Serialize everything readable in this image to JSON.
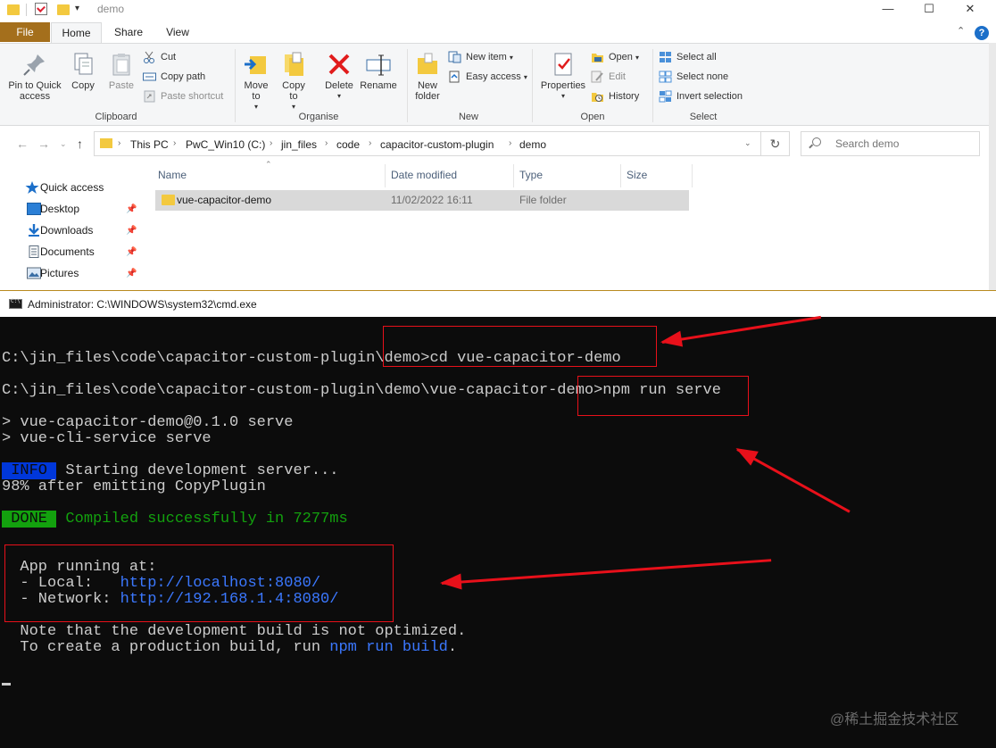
{
  "explorer": {
    "window_title": "demo",
    "tabs": {
      "file": "File",
      "home": "Home",
      "share": "Share",
      "view": "View"
    },
    "ribbon": {
      "pin_to_quick_access": "Pin to Quick access",
      "copy": "Copy",
      "paste": "Paste",
      "cut": "Cut",
      "copy_path": "Copy path",
      "paste_shortcut": "Paste shortcut",
      "clipboard_label": "Clipboard",
      "move_to": "Move to",
      "copy_to": "Copy to",
      "delete": "Delete",
      "rename": "Rename",
      "organise_label": "Organise",
      "new_folder": "New folder",
      "new_item": "New item",
      "easy_access": "Easy access",
      "new_label": "New",
      "properties": "Properties",
      "open": "Open",
      "edit": "Edit",
      "history": "History",
      "open_label": "Open",
      "select_all": "Select all",
      "select_none": "Select none",
      "invert_selection": "Invert selection",
      "select_label": "Select"
    },
    "breadcrumb": [
      "This PC",
      "PwC_Win10 (C:)",
      "jin_files",
      "code",
      "capacitor-custom-plugin",
      "demo"
    ],
    "search_placeholder": "Search demo",
    "nav_pane": [
      "Quick access",
      "Desktop",
      "Downloads",
      "Documents",
      "Pictures"
    ],
    "columns": {
      "name": "Name",
      "date": "Date modified",
      "type": "Type",
      "size": "Size"
    },
    "rows": [
      {
        "name": "vue-capacitor-demo",
        "date": "11/02/2022 16:11",
        "type": "File folder",
        "size": ""
      }
    ]
  },
  "cmd": {
    "title": "Administrator: C:\\WINDOWS\\system32\\cmd.exe",
    "line1": "C:\\jin_files\\code\\capacitor-custom-plugin\\demo>cd vue-capacitor-demo",
    "line2": "C:\\jin_files\\code\\capacitor-custom-plugin\\demo\\vue-capacitor-demo>npm run serve",
    "line3": "> vue-capacitor-demo@0.1.0 serve",
    "line4": "> vue-cli-service serve",
    "info_badge": " INFO ",
    "info_text": " Starting development server...",
    "progress_line": "98% after emitting CopyPlugin",
    "done_badge": " DONE ",
    "done_text": " Compiled successfully in 7277ms",
    "running_at": "  App running at:",
    "local_label": "  - Local:   ",
    "local_url": "http://localhost:8080/",
    "network_label": "  - Network: ",
    "network_url": "http://192.168.1.4:8080/",
    "note_line": "  Note that the development build is not optimized.",
    "prod_prefix": "  To create a production build, run ",
    "prod_cmd": "npm run build",
    "prod_suffix": "."
  },
  "watermark": "@稀土掘金技术社区",
  "colors": {
    "annotation_red": "#e8101a",
    "file_tab": "#a46f1c",
    "info_bg": "#0037da",
    "done_bg": "#13a10e",
    "link_blue": "#3b78ff"
  }
}
